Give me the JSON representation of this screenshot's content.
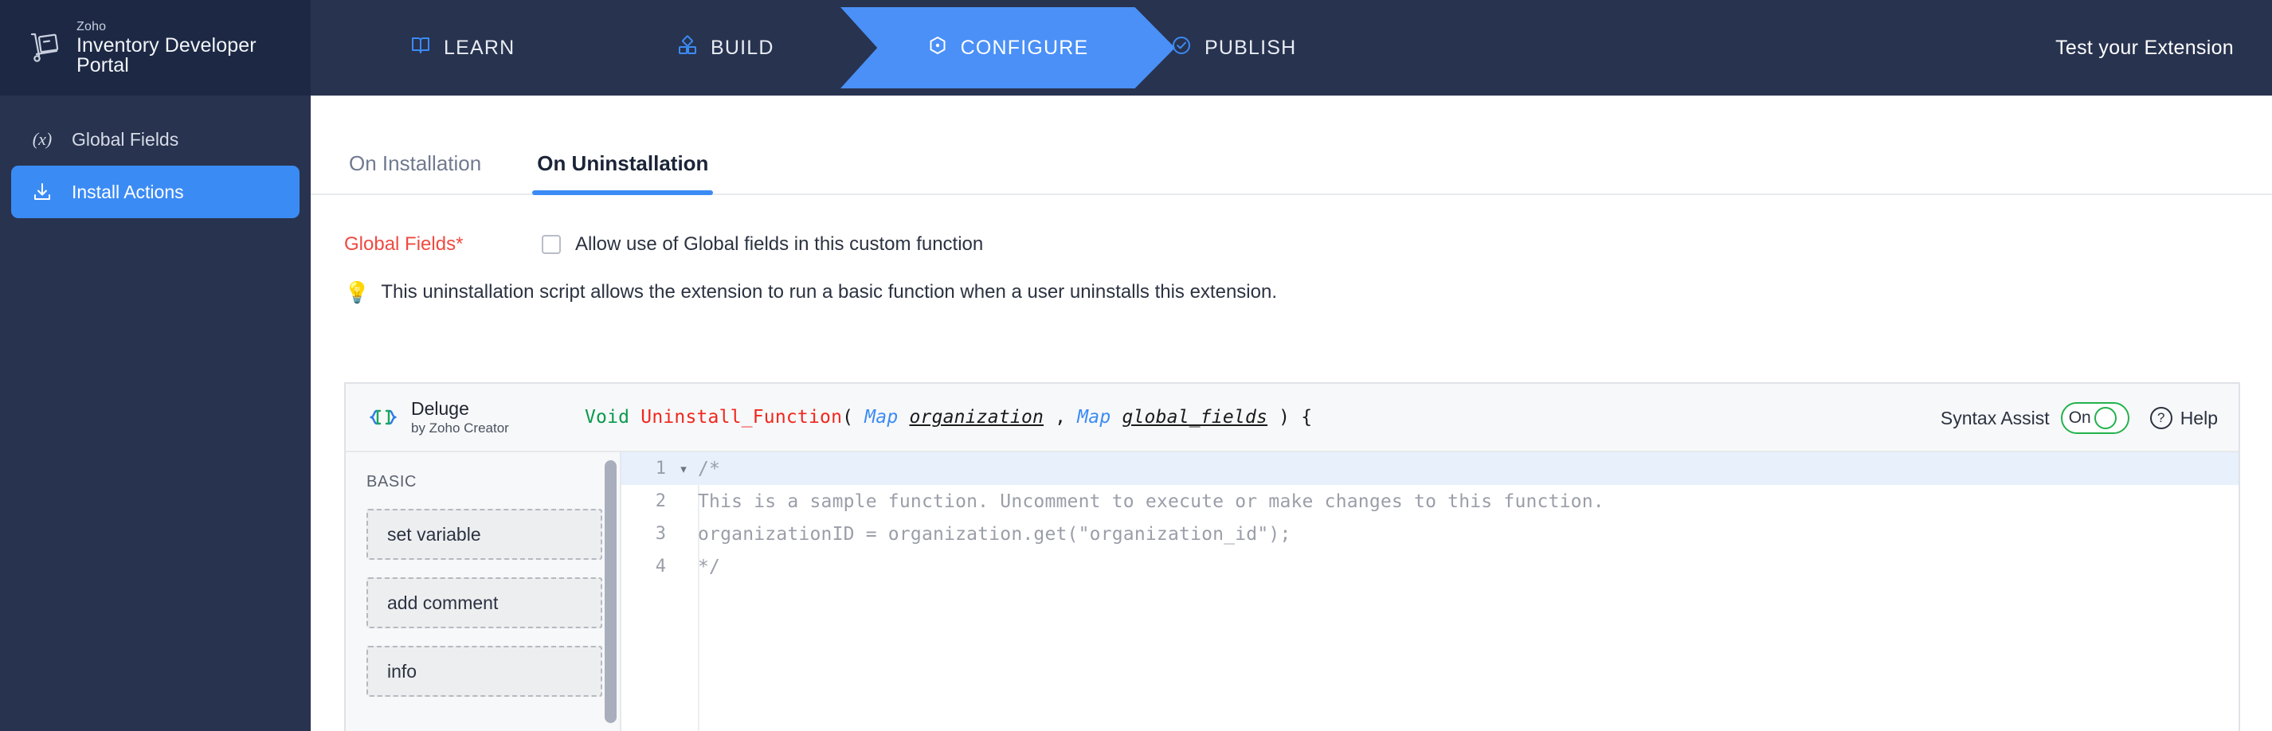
{
  "header": {
    "logo": {
      "brand": "Zoho",
      "product": "Inventory Developer Portal",
      "icon": "hand-truck-icon"
    },
    "nav": [
      {
        "id": "learn",
        "label": "LEARN",
        "icon": "book-icon",
        "active": false
      },
      {
        "id": "build",
        "label": "BUILD",
        "icon": "blocks-icon",
        "active": false
      },
      {
        "id": "configure",
        "label": "CONFIGURE",
        "icon": "settings-hexagon-icon",
        "active": true
      },
      {
        "id": "publish",
        "label": "PUBLISH",
        "icon": "check-circle-icon",
        "active": false
      }
    ],
    "test_extension": "Test your Extension"
  },
  "sidebar": {
    "items": [
      {
        "id": "global-fields",
        "label": "Global Fields",
        "icon": "fx-variable-icon",
        "active": false
      },
      {
        "id": "install-actions",
        "label": "Install Actions",
        "icon": "download-icon",
        "active": true
      }
    ]
  },
  "main": {
    "tabs": [
      {
        "id": "on-installation",
        "label": "On Installation",
        "active": false
      },
      {
        "id": "on-uninstallation",
        "label": "On Uninstallation",
        "active": true
      }
    ],
    "global_fields": {
      "label": "Global Fields*",
      "checkbox_label": "Allow use of Global fields in this custom function",
      "checked": false
    },
    "hint": {
      "icon": "lightbulb-icon",
      "glyph": "💡",
      "text": "This uninstallation script allows the extension to run a basic function when a user uninstalls this extension."
    }
  },
  "editor": {
    "brand": {
      "name": "Deluge",
      "by": "by Zoho Creator",
      "icon": "deluge-braces-icon"
    },
    "signature": {
      "return_type": "Void",
      "function_name": "Uninstall_Function",
      "open_paren": "(",
      "param1_type": "Map",
      "param1_name": "organization",
      "comma": ",",
      "param2_type": "Map",
      "param2_name": "global_fields",
      "close_paren": ")",
      "brace": "{"
    },
    "syntax_assist": {
      "label": "Syntax Assist",
      "state": "On"
    },
    "help": {
      "label": "Help",
      "icon": "question-circle-icon"
    },
    "palette": {
      "heading": "BASIC",
      "blocks": [
        {
          "label": "set variable"
        },
        {
          "label": "add comment"
        },
        {
          "label": "info"
        }
      ]
    },
    "code": {
      "lines": [
        {
          "num": "1",
          "fold": "▾",
          "text": "/*",
          "highlight": true
        },
        {
          "num": "2",
          "fold": "",
          "text": "This is a sample function. Uncomment to execute or make changes to this function.",
          "highlight": false
        },
        {
          "num": "3",
          "fold": "",
          "text": "organizationID = organization.get(\"organization_id\");",
          "highlight": false
        },
        {
          "num": "4",
          "fold": "",
          "text": "*/",
          "highlight": false
        }
      ]
    }
  },
  "colors": {
    "header_bg": "#28334f",
    "logo_bg": "#1c2844",
    "accent_blue": "#3b8bf5",
    "configure_blue": "#4a90f7",
    "required_red": "#ef4a41",
    "toggle_green": "#22b24c",
    "keyword_green": "#0a9a4e",
    "function_red": "#f0271f",
    "comment_gray": "#9a9ea8"
  }
}
